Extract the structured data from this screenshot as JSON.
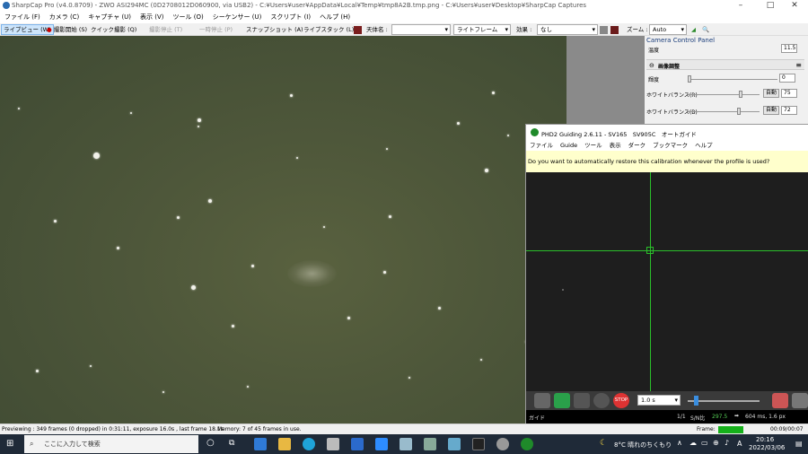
{
  "titlebar": {
    "title": "SharpCap Pro (v4.0.8709) - ZWO ASI294MC (0D2708012D060900, via USB2) - C:¥Users¥user¥AppData¥Local¥Temp¥tmp8A2B.tmp.png - C:¥Users¥user¥Desktop¥SharpCap Captures",
    "min": "–",
    "max": "□",
    "close": "✕"
  },
  "menubar": [
    "ファイル (F)",
    "カメラ (C)",
    "キャプチャ (U)",
    "表示 (V)",
    "ツール (O)",
    "シーケンサー (U)",
    "スクリプト (I)",
    "ヘルプ (H)"
  ],
  "toolbar": {
    "live_view": "ライブビュー (W)",
    "start_capture": "撮影開始 (S)",
    "quick_capture": "クイック撮影 (Q)",
    "stop_capture": "撮影停止 (T)",
    "pause": "一時停止 (P)",
    "snapshot": "スナップショット (A)",
    "live_stack": "ライブスタック (L)",
    "object_label": "天体名 :",
    "object_value": "",
    "light_frame": "ライトフレーム",
    "effect_label": "効果 :",
    "effect_value": "なし",
    "zoom_label": "ズーム :",
    "zoom_value": "Auto"
  },
  "ccp": {
    "title": "Camera Control Panel",
    "top_value": "11.5",
    "section": "画像調整",
    "brightness_label": "輝度",
    "brightness_value": "0",
    "wb_r_label": "ホワイトバランス(R)",
    "wb_r_value": "75",
    "wb_b_label": "ホワイトバランス(B)",
    "wb_b_value": "72",
    "auto": "自動",
    "temp_label": "温度"
  },
  "phd": {
    "title": "PHD2 Guiding 2.6.11 - SV165　SV905C　オートガイド",
    "menu": [
      "ファイル",
      "Guide",
      "ツール",
      "表示",
      "ダーク",
      "ブックマーク",
      "ヘルプ"
    ],
    "info": "Do you want to automatically restore this calibration whenever the profile is used?",
    "exposure": "1.0 s",
    "stop": "STOP",
    "status_left": "ガイド",
    "frame": "1/1",
    "snr": "S/N比",
    "snr_value": "297.5",
    "timing": "604 ms, 1.6 px"
  },
  "status": {
    "left": "Previewing : 349 frames (0 dropped) in 0:31:11, exposure 16.0s , last frame 18.1s",
    "memory": "Memory: 7 of 45 frames in use.",
    "frame_label": "Frame:",
    "time": "00:09/00:07"
  },
  "taskbar": {
    "search": "ここに入力して検索",
    "weather": "8°C  晴れのちくもり",
    "time": "20:16",
    "date": "2022/03/06",
    "ime": "A"
  },
  "colors": {
    "crosshair": "#2ac02a",
    "accent": "#0078d7"
  }
}
